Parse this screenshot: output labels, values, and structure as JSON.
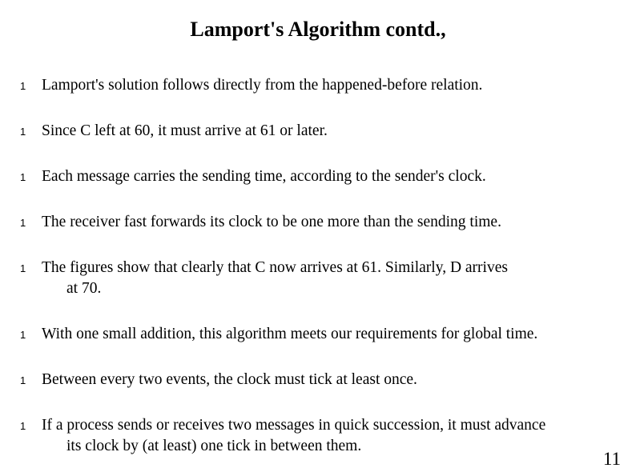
{
  "slide": {
    "title": "Lamport's Algorithm contd.,",
    "bullet_marker": "1",
    "page_number": "11",
    "bullets": [
      {
        "line1": "Lamport's solution follows directly from the happened-before relation.",
        "line2": ""
      },
      {
        "line1": "Since C left at 60, it must arrive at 61 or later.",
        "line2": ""
      },
      {
        "line1": "Each message carries the sending time, according to the sender's clock.",
        "line2": ""
      },
      {
        "line1": "The receiver fast forwards its clock to be one more than the sending time.",
        "line2": ""
      },
      {
        "line1": "The figures show that clearly that C now arrives at 61.  Similarly, D arrives",
        "line2": "at 70."
      },
      {
        "line1": "With one small addition, this algorithm meets our requirements for global time.",
        "line2": ""
      },
      {
        "line1": "Between every two events, the clock must tick at least once.",
        "line2": ""
      },
      {
        "line1": "If a process sends or receives two messages in quick succession, it must advance",
        "line2": "its clock by (at least) one tick in between them."
      }
    ]
  },
  "colors": {
    "background": "#ffffff",
    "text": "#000000"
  }
}
